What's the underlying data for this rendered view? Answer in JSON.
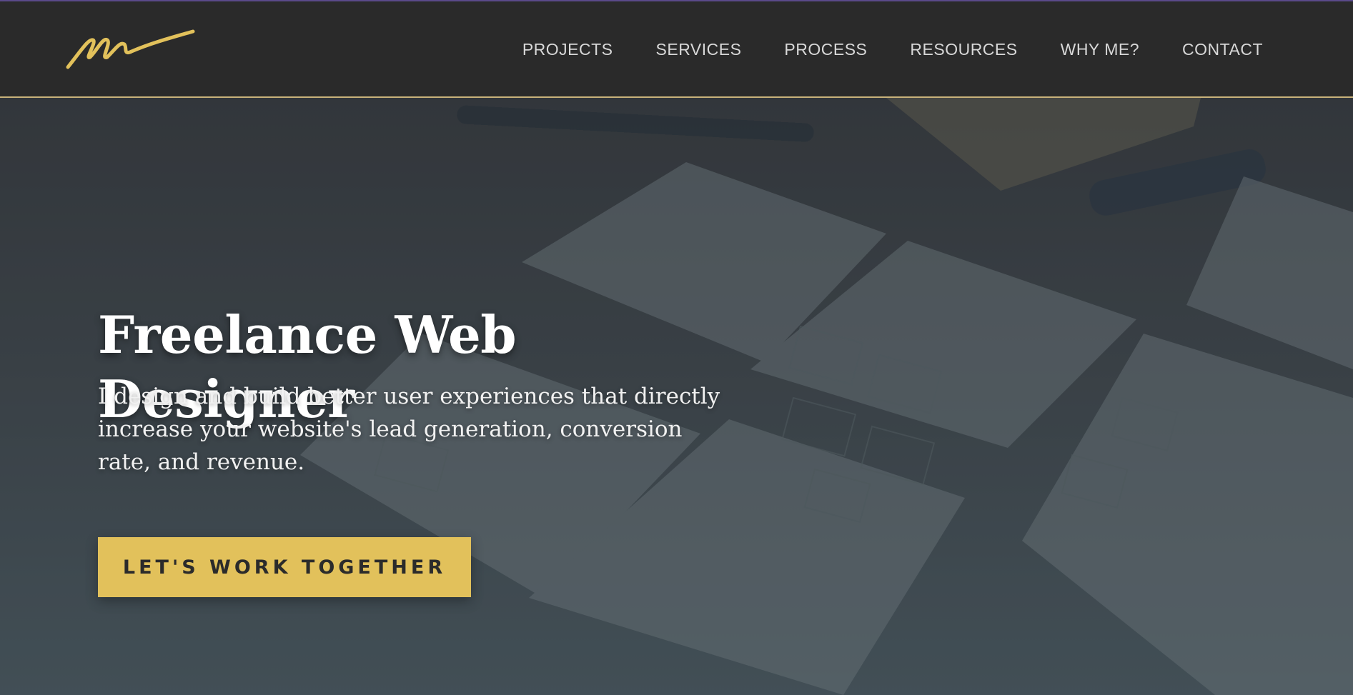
{
  "header": {
    "logo_icon": "signature-logo-icon",
    "nav": [
      {
        "label": "PROJECTS"
      },
      {
        "label": "SERVICES"
      },
      {
        "label": "PROCESS"
      },
      {
        "label": "RESOURCES"
      },
      {
        "label": "WHY ME?"
      },
      {
        "label": "CONTACT"
      }
    ]
  },
  "hero": {
    "title": "Freelance Web Designer",
    "subtitle": "I design and build better user experiences that directly increase your website's lead generation, conversion rate, and revenue.",
    "cta_label": "LET'S WORK TOGETHER"
  },
  "colors": {
    "header_bg": "#2a2a2a",
    "accent": "#e2c15b",
    "header_border": "#c9b27a"
  }
}
